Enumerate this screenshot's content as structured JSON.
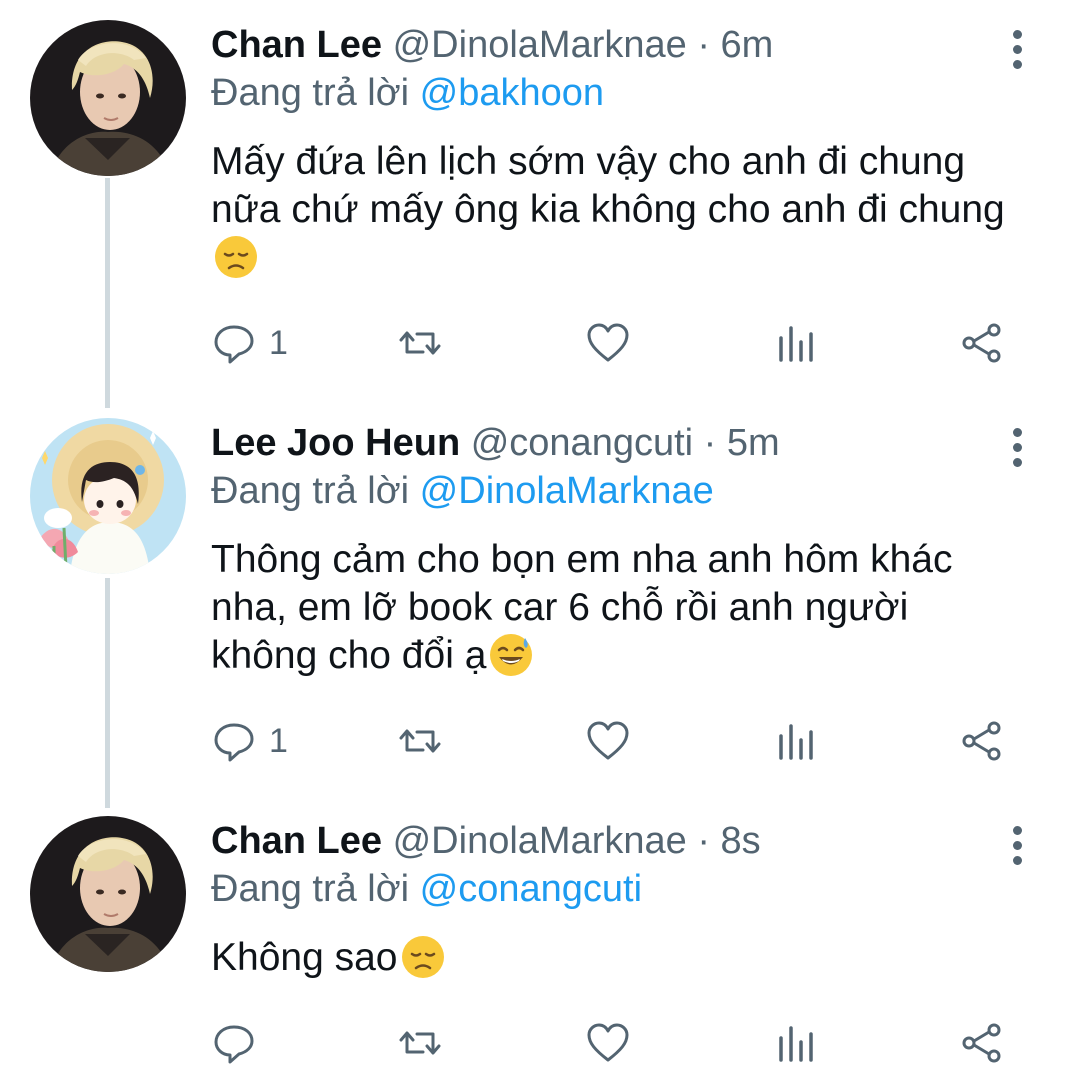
{
  "tweets": [
    {
      "name": "Chan Lee",
      "handle": "@DinolaMarknae",
      "dot": "·",
      "time": "6m",
      "replying_prefix": "Đang trả lời",
      "replying_to": "@bakhoon",
      "text": "Mấy đứa lên lịch sớm vậy cho anh đi chung nữa chứ mấy ông kia không cho anh đi chung",
      "emoji": "disappointed-face",
      "reply_count": "1",
      "avatar": "person-blonde-dark-jacket"
    },
    {
      "name": "Lee Joo Heun",
      "handle": "@conangcuti",
      "dot": "·",
      "time": "5m",
      "replying_prefix": "Đang trả lời",
      "replying_to": "@DinolaMarknae",
      "text": "Thông cảm cho bọn em nha anh hôm khác nha, em lỡ book car 6 chỗ rồi anh người không cho đổi ạ",
      "emoji": "grinning-face-with-sweat",
      "reply_count": "1",
      "avatar": "illustrated-girl-straw-hat"
    },
    {
      "name": "Chan Lee",
      "handle": "@DinolaMarknae",
      "dot": "·",
      "time": "8s",
      "replying_prefix": "Đang trả lời",
      "replying_to": "@conangcuti",
      "text": "Không sao",
      "emoji": "disappointed-face",
      "reply_count": "",
      "avatar": "person-blonde-dark-jacket"
    }
  ],
  "icons": {
    "reply": "speech-bubble-icon",
    "retweet": "retweet-icon",
    "like": "heart-icon",
    "analytics": "bar-chart-icon",
    "share": "share-icon",
    "more": "vertical-dots-icon"
  },
  "colors": {
    "accent": "#1d9bf0",
    "secondary_text": "#536471",
    "thread_line": "#cfd9de"
  }
}
